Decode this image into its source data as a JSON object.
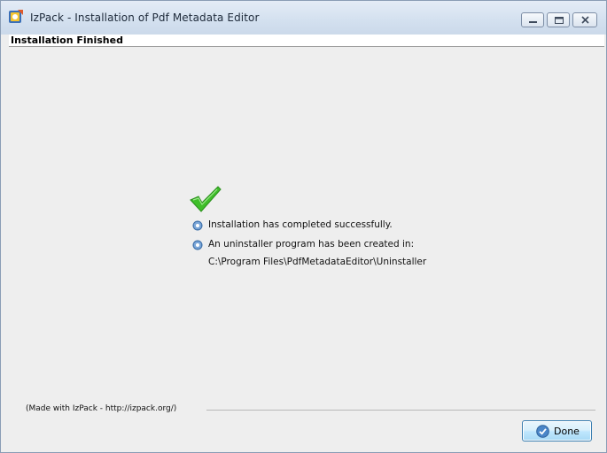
{
  "window": {
    "title": "IzPack - Installation of  Pdf Metadata Editor"
  },
  "panel": {
    "heading": "Installation Finished"
  },
  "messages": {
    "completed": "Installation has completed successfully.",
    "uninstaller_created": "An uninstaller program has been created in:",
    "uninstaller_path": "C:\\Program Files\\PdfMetadataEditor\\Uninstaller"
  },
  "footer": {
    "made_with": "(Made with IzPack - http://izpack.org/)",
    "done_label": "Done"
  },
  "icons": {
    "app": "izpack-app-icon",
    "success": "green-checkmark-icon",
    "info": "gear-info-icon",
    "done": "check-circle-icon"
  },
  "colors": {
    "accent_blue": "#3c7fb1",
    "check_green": "#3fbf2a"
  }
}
